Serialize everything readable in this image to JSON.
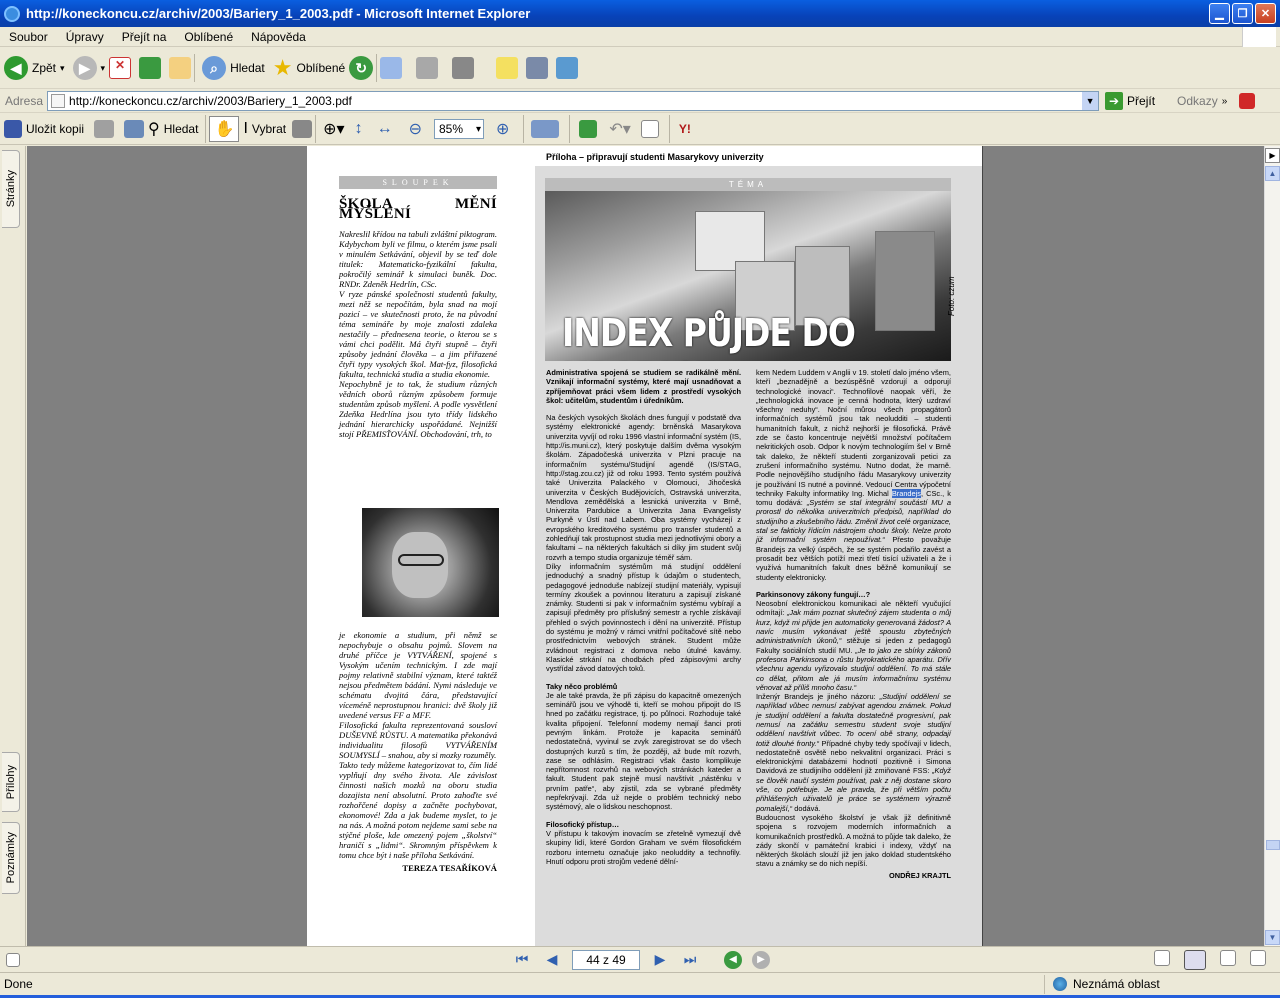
{
  "window": {
    "title": "http://koneckoncu.cz/archiv/2003/Bariery_1_2003.pdf - Microsoft Internet Explorer"
  },
  "menu": [
    "Soubor",
    "Úpravy",
    "Přejít na",
    "Oblíbené",
    "Nápověda"
  ],
  "toolbar": {
    "back": "Zpět",
    "search": "Hledat",
    "favorites": "Oblíbené"
  },
  "address": {
    "label": "Adresa",
    "url": "http://koneckoncu.cz/archiv/2003/Bariery_1_2003.pdf",
    "go": "Přejít",
    "links": "Odkazy"
  },
  "pdf_toolbar": {
    "save_copy": "Uložit kopii",
    "search": "Hledat",
    "select": "Vybrat",
    "zoom": "85%"
  },
  "side_tabs": {
    "pages": "Stránky",
    "attachments": "Přílohy",
    "comments": "Poznámky"
  },
  "page": {
    "sloupek": "SLOUPEK",
    "col1_heading": "ŠKOLA MĚNÍ MYŠLENÍ",
    "col1_text_a": "Nakreslil křídou na tabuli zvláštní piktogram. Kdybychom byli ve filmu, o kterém jsme psali v minulém Setkávání, objevil by se teď dole titulek: Matematicko-fyzikální fakulta, pokročilý seminář k simulaci buněk. Doc. RNDr. Zdeněk Hedrlín, CSc.",
    "col1_text_b": "V ryze pánské společnosti studentů fakulty, mezi něž se nepočítám, byla snad na mojí pozicí – ve skutečnosti proto, že na původní téma semináře by moje znalosti zdaleka nestačily – přednesena teorie, o kterou se s vámi chci podělit. Má čtyři stupně – čtyři způsoby jednání člověka – a jim přiřazené čtyři typy vysokých škol. Mat-fyz, filosofická fakulta, technická studia a studia ekonomie.",
    "col1_text_c": "Nepochybně je to tak, že studium různých vědních oborů různým způsobem formuje studentům způsob myšlení. A podle vysvětlení Zdeňka Hedrlína jsou tyto třídy lidského jednání hierarchicky uspořádané. Nejnižší stojí PŘEMISŤOVÁNÍ. Obchodování, trh, to",
    "col1_text_d": "je ekonomie a studium, při němž se nepochybuje o obsahu pojmů. Slovem na druhé příčce je VYTVÁŘENÍ, spojené s Vysokým učením technickým. I zde mají pojmy relativně stabilní význam, které taktéž nejsou předmětem bádání. Nymi následuje ve schématu dvojitá čára, představující víceméně neprostupnou hranici: dvě školy již uvedené versus FF a MFF.",
    "col1_text_e": "Filosofická fakulta reprezentovaná sousloví DUŠEVNÉ RŮSTU. A matematika překonává individualitu filosofů VYTVÁŘENÍM SOUMYSLÍ – snahou, aby si mozky rozuměly.",
    "col1_text_f": "Takto tedy můžeme kategorizovat to, čím lidé vyplňují dny svého života. Ale závislost činnosti našich mozků na oboru studia dozajista není absolutní. Proto zahoďte své rozhořčené dopisy a začněte pochybovat, ekonomové! Zda a jak budeme myslet, to je na nás. A možná potom nejdeme sami sebe na stýčné ploše, kde omezený pojem „školství“ hraničí s „lidmi“. Skromným příspěvkem k tomu chce být i naše příloha Setkávání.",
    "col1_signature": "TEREZA TESAŘÍKOVÁ",
    "header": "Příloha – připravují studenti Masarykovy univerzity",
    "tema": "TÉMA",
    "photo_title": "INDEX PŮJDE DO KRABICE",
    "photo_credit": "Foto: czum",
    "c2_lead": "Administrativa spojená se studiem se radikálně mění. Vznikají informační systémy, které mají usnadňovat a zpříjemňovat práci všem lidem z prostředí vysokých škol: učitelům, studentům i úředníkům.",
    "c2_p1": "Na českých vysokých školách dnes fungují v podstatě dva systémy elektronické agendy: brněnská Masarykova univerzita vyvíjí od roku 1996 vlastní informační systém (IS, http://is.muni.cz), který poskytuje dalším dvěma vysokým školám. Západočeská univerzita v Plzni pracuje na informačním systému/Studijní agendě (IS/STAG, http://stag.zcu.cz) již od roku 1993. Tento systém používá také Univerzita Palackého v Olomouci, Jihočeská univerzita v Českých Budějovicích, Ostravská univerzita, Mendlova zemědělská a lesnická univerzita v Brně, Univerzita Pardubice a Univerzita Jana Evangelisty Purkyně v Ústí nad Labem. Oba systémy vycházejí z evropského kreditového systému pro transfer studentů a zohledňují tak prostupnost studia mezi jednotlivými obory a fakultami – na některých fakultách si díky jim student svůj rozvrh a tempo studia organizuje téměř sám.",
    "c2_p2": "Díky informačním systémům má studijní oddělení jednoduchý a snadný přístup k údajům o studentech, pedagogové jednoduše nabízejí studijní materiály, vypisují termíny zkoušek a povinnou literaturu a zapisují získané známky. Studenti si pak v informačním systému vybírají a zapisují předměty pro příslušný semestr a rychle získávají přehled o svých povinnostech i dění na univerzitě. Přístup do systému je možný v rámci vnitřní počítačové sítě nebo prostřednictvím webových stránek. Student může zvládnout registraci z domova nebo útulné kavárny. Klasické strkání na chodbách před zápisovými archy vystřídal závod datových toků.",
    "c2_sub1": "Taky něco problémů",
    "c2_p3": "Je ale také pravda, že při zápisu do kapacitně omezených seminářů jsou ve výhodě ti, kteří se mohou připojit do IS hned po začátku registrace, tj. po půlnoci. Rozhoduje také kvalita připojení. Telefonní modemy nemají šanci proti pevným linkám. Protože je kapacita seminářů nedostatečná, vyvinul se zvyk zaregistrovat se do všech dostupných kurzů s tím, že později, až bude mít rozvrh, zase se odhlásím. Registraci však často komplikuje nepřítomnost rozvrhů na webových stránkách kateder a fakult. Student pak stejně musí navštívit „nástěnku v prvním patře“, aby zjistil, zda se vybrané předměty nepřekrývají. Zda už nejde o problém technický nebo systémový, ale o lidskou neschopnost.",
    "c2_sub2": "Filosofický přístup…",
    "c2_p4": "V přístupu k takovým inovacím se zřetelně vymezují dvě skupiny lidí, které Gordon Graham ve svém filosofickém rozboru internetu označuje jako neoluddity a technofily. Hnutí odporu proti strojům vedené dělní-",
    "c3_p1a": "kem Nedem Luddem v Anglii v 19. století dalo jméno všem, kteří „beznadějně a bezúspěšně vzdorují a odporují technologické inovaci“. Technofilové naopak věří, že „technologická inovace je cenná hodnota, který uzdraví všechny neduhy“. Noční můrou všech propagátorů informačních systémů jsou tak neoludditi – studenti humanitních fakult, z nichž nejhorší je filosofická. Právě zde se často koncentruje největší množství počítačem nekritických osob. Odpor k novým technologiím šel v Brně tak daleko, že někteří studenti zorganizovali petici za zrušení informačního systému. Nutno dodat, že marně. Podle nejnovějšího studijního řádu Masarykovy univerzity je používání IS nutné a povinné. Vedoucí Centra výpočetní techniky Fakulty informatiky Ing. Michal",
    "c3_hl": "Brandejs",
    "c3_p1b": ", CSc., k tomu dodává:",
    "c3_q1": "„Systém se stal integrální součástí MU a prorostl do několika univerzitních předpisů, například do studijního a zkušebního řádu. Změnil život celé organizace, stal se fakticky řídicím nástrojem chodu školy. Nelze proto již informační systém nepoužívat.“",
    "c3_p1c": "Přesto považuje Brandejs za velký úspěch, že se systém podařilo zavést a prosadit bez větších potíží mezi třetí tisící uživateli a že i využívá humanitních fakult dnes běžně komunikují se studenty elektronicky.",
    "c3_sub1": "Parkinsonovy zákony fungují…?",
    "c3_p2": "Neosobní elektronickou komunikaci ale někteří vyučující odmítají:",
    "c3_q2": "„Jak mám poznat skutečný zájem studenta o můj kurz, když mi přijde jen automaticky generovaná žádost? A navíc musím vykonávat ještě spoustu zbytečných administrativních úkonů,“",
    "c3_p2b": "stěžuje si jeden z pedagogů Fakulty sociálních studií MU.",
    "c3_q3": "„Je to jako ze sbírky zákonů profesora Parkinsona o růstu byrokratického aparátu. Dřív všechnu agendu vyřizovalo studijní oddělení. To má stále co dělat, přitom ale já musím informačnímu systému věnovat až příliš mnoho času.“",
    "c3_p3": "Inženýr Brandejs je jiného názoru:",
    "c3_q4": "„Studijní oddělení se například vůbec nemusí zabývat agendou známek. Pokud je studijní oddělení a fakulta dostatečně progresivní, pak nemusí na začátku semestru student svoje studijní oddělení navštívit vůbec. To ocení obě strany, odpadají totiž dlouhé fronty.“",
    "c3_p3b": "Případné chyby tedy spočívají v lidech, nedostatečně osvětě nebo nekvalitní organizaci. Práci s elektronickými databázemi hodnotí pozitivně i Simona Davidová ze studijního oddělení již zmiňované FSS:",
    "c3_q5": "„Když se člověk naučí systém používat, pak z něj dostane skoro vše, co potřebuje. Je ale pravda, že při větším počtu přihlášených uživatelů je práce se systémem výrazně pomalejší,“",
    "c3_p3c": "dodává.",
    "c3_p4": "Budoucnost vysokého školství je však již definitivně spojena s rozvojem moderních informačních a komunikačních prostředků. A možná to půjde tak daleko, že zády skončí v památeční krabici i indexy, vždyť na některých školách slouží již jen jako doklad studentského stavu a známky se do nich nepíší.",
    "c3_signature": "ONDŘEJ KRAJTL"
  },
  "nav": {
    "page_indicator": "44 z 49"
  },
  "status": {
    "left": "Done",
    "zone": "Neznámá oblast"
  }
}
